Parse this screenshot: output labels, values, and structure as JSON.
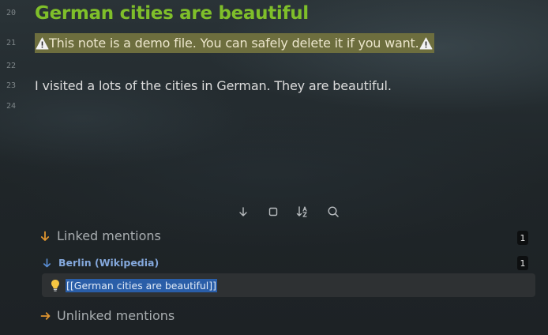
{
  "editor": {
    "line_numbers": [
      "20",
      "21",
      "22",
      "23",
      "24"
    ],
    "title": "German cities are beautiful",
    "warning_text": "This note is a demo file. You can safely delete it if you want.",
    "body_text": "I visited a lots of the cities in German. They are beautiful."
  },
  "backlinks": {
    "toolbar": {
      "buttons": [
        "collapse-results",
        "show-more-context",
        "change-sort-order",
        "search"
      ]
    },
    "linked": {
      "label": "Linked mentions",
      "count": "1",
      "sources": [
        {
          "title": "Berlin (Wikipedia)",
          "count": "1",
          "match": "[[German cities are beautiful]]"
        }
      ]
    },
    "unlinked": {
      "label": "Unlinked mentions"
    }
  },
  "colors": {
    "title": "#7fbf2a",
    "highlight_bg": "#6d6e3e",
    "arrow_orange": "#e0952f",
    "arrow_blue": "#5b8fd6",
    "link_selection": "#2a5ea8",
    "source_title": "#84a8dc"
  }
}
